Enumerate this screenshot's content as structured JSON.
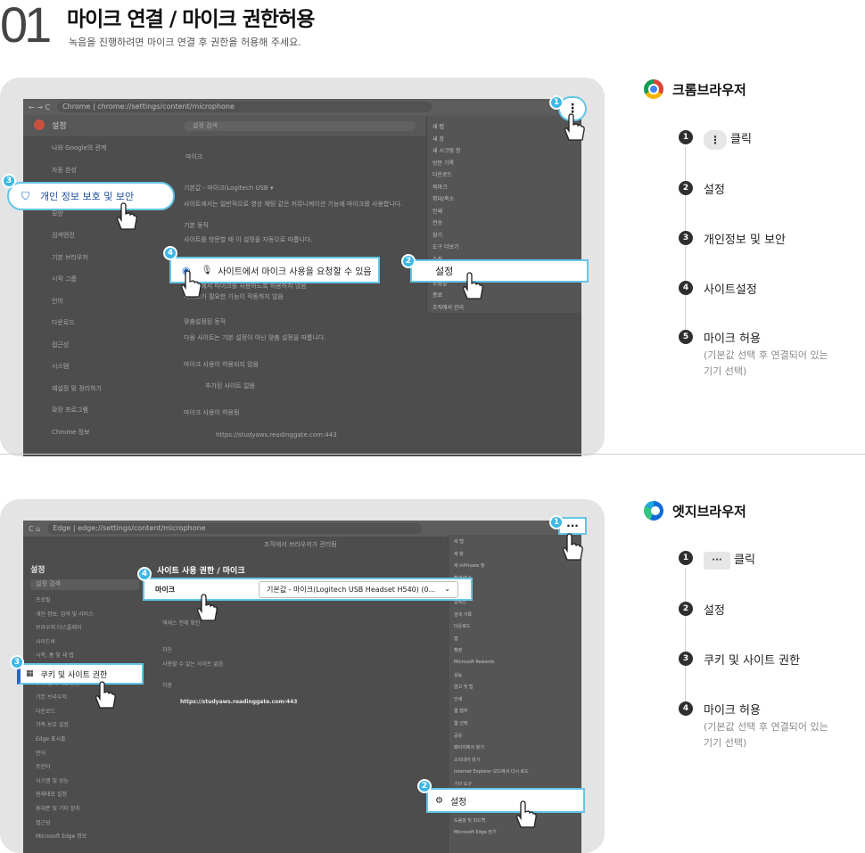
{
  "header": {
    "number": "01",
    "title": "마이크 연결 / 마이크 권한허용",
    "subtitle": "녹음을 진행하려면 마이크 연결 후 권한을 허용해 주세요."
  },
  "chrome": {
    "brand": "크롬브라우저",
    "url": "Chrome  |  chrome://settings/content/microphone",
    "settings_title": "설정",
    "search_placeholder": "설정 검색",
    "sidebar": [
      "나와 Google의 관계",
      "자동 완성",
      "개인 정보 보호 및 보안",
      "모양",
      "검색엔진",
      "기본 브라우저",
      "시작 그룹",
      "언어",
      "다운로드",
      "접근성",
      "시스템",
      "재설정 및 정리하기",
      "확장 프로그램",
      "Chrome 정보"
    ],
    "content_heading": "마이크",
    "content_lines": [
      "기본값 - 마이크(Logitech USB ▾",
      "사이트에서는 일반적으로 영상 채팅 같은 커뮤니케이션 기능에 마이크를 사용합니다.",
      "기본 동작",
      "사이트를 방문할 때 이 설정을 자동으로 따릅니다.",
      "사이트에서 마이크를 사용하도록 허용하지 않음",
      "마이크가 필요한 기능이 작동하지 않음",
      "맞춤설정된 동작",
      "다음 사이트는 기본 설정이 아닌 맞춤 설정을 따릅니다.",
      "마이크 사용이 허용되지 않음",
      "추가된 사이트 없음",
      "마이크 사용이 허용됨",
      "https://studyaws.readinggate.com:443"
    ],
    "menu_items": [
      "새 탭",
      "새 창",
      "새 시크릿 창",
      "방문 기록",
      "다운로드",
      "북마크",
      "확대/축소",
      "인쇄",
      "전송",
      "찾기",
      "도구 더보기",
      "수정",
      "설정",
      "도움말",
      "종료",
      "조직에서 관리"
    ],
    "callouts": {
      "privacy": "개인 정보 보호 및 보안",
      "site_mic": "사이트에서 마이크 사용을 요청할 수 있음",
      "settings": "설정"
    },
    "steps": [
      {
        "num": "1",
        "label": "클릭",
        "chip": "⋮"
      },
      {
        "num": "2",
        "label": "설정"
      },
      {
        "num": "3",
        "label": "개인정보 및 보안"
      },
      {
        "num": "4",
        "label": "사이트설정"
      },
      {
        "num": "5",
        "label": "마이크 허용",
        "sub": "(기본값 선택 후 연결되어 있는 기기 선택)"
      }
    ]
  },
  "edge": {
    "brand": "엣지브라우저",
    "url": "Edge  |  edge://settings/content/microphone",
    "managed_notice": "조직에서 브라우저가 관리됨",
    "settings_title": "설정",
    "search_placeholder": "설정 검색",
    "sidebar": [
      "프로필",
      "개인 정보, 검색 및 서비스",
      "브라우저 디스플레이",
      "사이드바",
      "시작, 홈 및 새 탭",
      "공유, 복사 및 붙여넣기",
      "쿠키 및 사이트 권한",
      "기본 브라우저",
      "다운로드",
      "가족 보호 설정",
      "Edge 표시줄",
      "언어",
      "프린터",
      "시스템 및 성능",
      "원래대로 설정",
      "휴대폰 및 기타 장치",
      "접근성",
      "Microsoft Edge 정보"
    ],
    "breadcrumb": "사이트 사용 권한 / 마이크",
    "content_lines": [
      "액세스 전에 확인",
      "차단",
      "사용할 수 없는 사이트 없음",
      "허용",
      "https://studyaws.readinggate.com:443"
    ],
    "menu_items": [
      "새 탭",
      "새 창",
      "새 InPrivate 창",
      "확대/축소",
      "즐겨찾기",
      "컬렉션",
      "검색 기록",
      "다운로드",
      "앱",
      "확장",
      "Microsoft Rewards",
      "성능",
      "알고 및 팁",
      "인쇄",
      "웹 캡처",
      "웹 선택",
      "공유",
      "페이지에서 찾기",
      "소리내어 읽기",
      "Internet Explorer 모드에서 다시 로드",
      "기타 도구",
      "설정",
      "사이드바 숨기기",
      "도움말 및 피드백",
      "Microsoft Edge 닫기"
    ],
    "callouts": {
      "mic_label": "마이크",
      "mic_value": "기본값 - 마이크(Logitech USB Headset H540) (0...",
      "cookies": "쿠키 및 사이트 권한",
      "settings": "설정"
    },
    "steps": [
      {
        "num": "1",
        "label": "클릭",
        "chip": "···"
      },
      {
        "num": "2",
        "label": "설정"
      },
      {
        "num": "3",
        "label": "쿠키 및 사이트 권한"
      },
      {
        "num": "4",
        "label": "마이크 허용",
        "sub": "(기본값 선택 후 연결되어 있는 기기 선택)"
      }
    ]
  }
}
